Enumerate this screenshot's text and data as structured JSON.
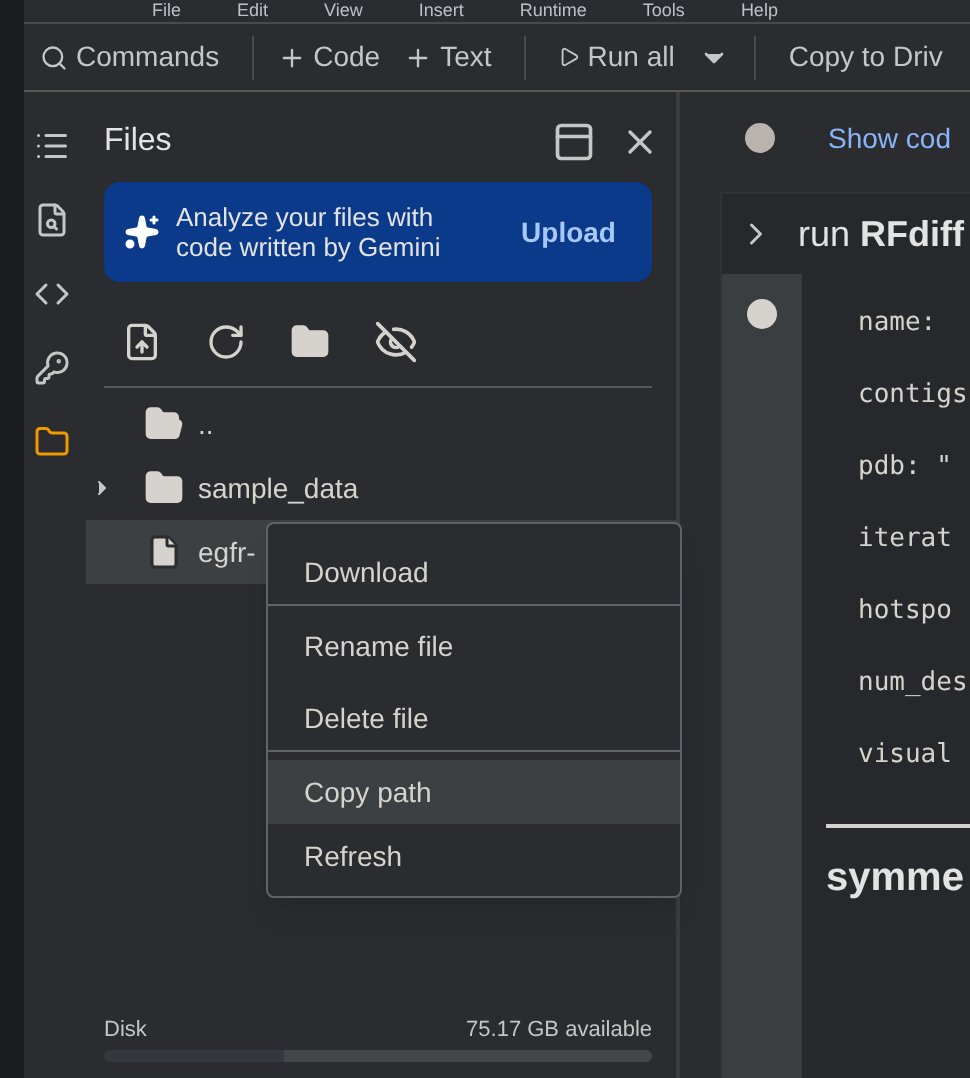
{
  "menu_bar": [
    "File",
    "Edit",
    "View",
    "Insert",
    "Runtime",
    "Tools",
    "Help"
  ],
  "toolbar": {
    "commands": "Commands",
    "add_code": "Code",
    "add_text": "Text",
    "run_all": "Run all",
    "copy": "Copy to Driv"
  },
  "rail": [
    {
      "kind": "toc",
      "selected": false
    },
    {
      "kind": "find",
      "selected": false
    },
    {
      "kind": "code",
      "selected": false
    },
    {
      "kind": "secrets",
      "selected": false
    },
    {
      "kind": "files",
      "selected": true
    }
  ],
  "files_panel": {
    "title": "Files",
    "banner": {
      "text": "Analyze your files with code written by Gemini",
      "button": "Upload"
    },
    "tree": [
      {
        "kind": "folder",
        "name": "..",
        "expandable": false,
        "selected": false
      },
      {
        "kind": "folder",
        "name": "sample_data",
        "expandable": true,
        "selected": false
      },
      {
        "kind": "file",
        "name": "egfr-",
        "expandable": false,
        "selected": true
      }
    ],
    "disk": {
      "label": "Disk",
      "available": "75.17 GB available",
      "level": 0.33
    }
  },
  "context_menu": [
    {
      "label": "Download",
      "highlighted": false,
      "divider_after": true
    },
    {
      "label": "Rename file",
      "highlighted": false,
      "divider_after": false
    },
    {
      "label": "Delete file",
      "highlighted": false,
      "divider_after": true
    },
    {
      "label": "Copy path",
      "highlighted": true,
      "divider_after": false
    },
    {
      "label": "Refresh",
      "highlighted": false,
      "divider_after": false
    }
  ],
  "notebook": {
    "show_code": "Show cod",
    "section": {
      "prefix": "run ",
      "title": "RFdiff"
    },
    "code_lines": [
      "name:",
      "contigs",
      "pdb: \"",
      "iterat",
      "hotspo",
      "num_des",
      "visual"
    ],
    "next_heading": "symme"
  }
}
